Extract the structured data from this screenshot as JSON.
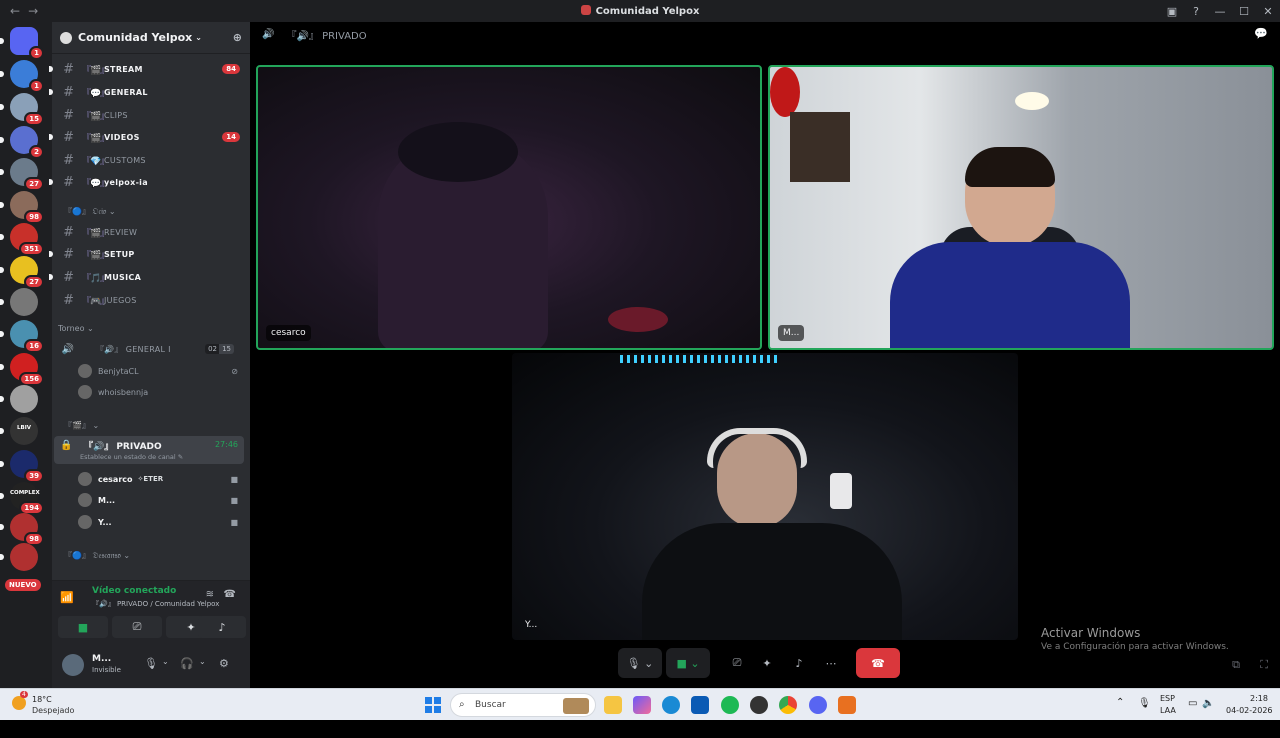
{
  "window": {
    "title": "Comunidad Yelpox",
    "nav_back": "←",
    "nav_forward": "→",
    "controls": [
      "▣",
      "?",
      "—",
      "☐",
      "✕"
    ]
  },
  "servers": [
    {
      "badge": "1",
      "color": "#5865f2"
    },
    {
      "badge": "1",
      "color": "#3b7dd8"
    },
    {
      "badge": "15",
      "color": "#8aa0b8"
    },
    {
      "badge": "2",
      "color": "#5a6fd0"
    },
    {
      "badge": "27",
      "color": "#6b7b8b"
    },
    {
      "badge": "98",
      "color": "#8b6b5b"
    },
    {
      "badge": "351",
      "color": "#c8302a"
    },
    {
      "badge": "27",
      "color": "#e8c020"
    },
    {
      "badge": "",
      "color": "#777"
    },
    {
      "badge": "16",
      "color": "#4a90b0"
    },
    {
      "badge": "156",
      "color": "#d02020"
    },
    {
      "badge": "",
      "color": "#a0a0a0"
    },
    {
      "badge": "",
      "color": "#333",
      "text": "LBIV"
    },
    {
      "badge": "39",
      "color": "#1b2a6b"
    },
    {
      "badge": "194",
      "color": "#222",
      "text": "COMPLEX"
    },
    {
      "badge": "98",
      "color": "#b03030"
    },
    {
      "badge": "",
      "color": "#b03030"
    }
  ],
  "nuevo_label": "NUEVO",
  "guild": {
    "name": "Comunidad Yelpox",
    "caret": "⌄"
  },
  "channels": [
    {
      "emo": "『🎬』",
      "name": "STREAM",
      "unread": true,
      "count": "84"
    },
    {
      "emo": "『💬』",
      "name": "GENERAL",
      "unread": true,
      "count": ""
    },
    {
      "emo": "『🎬』",
      "name": "CLIPS",
      "unread": false,
      "count": ""
    },
    {
      "emo": "『🎬』",
      "name": "VIDEOS",
      "unread": true,
      "count": "14"
    },
    {
      "emo": "『💎』",
      "name": "CUSTOMS",
      "unread": false,
      "count": ""
    },
    {
      "emo": "『💬』",
      "name": "yelpox-ia",
      "unread": true,
      "count": ""
    }
  ],
  "category_ocio": "『🔵』 𝔒𝔠𝔦𝔬 ⌄",
  "channels_ocio": [
    {
      "emo": "『🎬』",
      "name": "REVIEW",
      "unread": false
    },
    {
      "emo": "『🎬』",
      "name": "SETUP",
      "unread": true
    },
    {
      "emo": "『🎵』",
      "name": "MUSICA",
      "unread": true
    },
    {
      "emo": "『🎮』",
      "name": "JUEGOS",
      "unread": false
    }
  ],
  "category_torneo": "Torneo ⌄",
  "voice_general": {
    "name": "『🔊』 GENERAL I",
    "counts": [
      "02",
      "15"
    ]
  },
  "voice_general_members": [
    "BenjytaCL",
    "whoisbennja"
  ],
  "category_unnamed": "『🎬』 ⌄",
  "voice_private": {
    "name": "『🔊』 PRIVADO",
    "time": "27:46",
    "status": "Establece un estado de canal ✎"
  },
  "voice_private_members": [
    {
      "name": "cesarco",
      "tag": "✧ETER"
    },
    {
      "name": "M...",
      "tag": ""
    },
    {
      "name": "Y...",
      "tag": ""
    }
  ],
  "category_descanso": "『🔵』 𝔇𝔢𝔰𝔠𝔞𝔫𝔰𝔬 ⌄",
  "voice_panel": {
    "status": "Vídeo conectado",
    "location": "『🔊』 PRIVADO / Comunidad Yelpox"
  },
  "user": {
    "name": "M...",
    "status": "Invisible"
  },
  "stage": {
    "channel": "『🔊』 PRIVADO"
  },
  "tiles": [
    {
      "label": "cesarco",
      "speaking": true
    },
    {
      "label": "M...",
      "speaking": true
    },
    {
      "label": "Y...",
      "speaking": false
    }
  ],
  "watermark": {
    "title": "Activar Windows",
    "subtitle": "Ve a Configuración para activar Windows."
  },
  "taskbar": {
    "weather_temp": "18°C",
    "weather_cond": "Despejado",
    "weather_badge": "4",
    "search_placeholder": "Buscar",
    "lang": "ESP",
    "lang2": "LAA",
    "time": "2:18",
    "date": "04-02-2026"
  },
  "colors": {
    "accent_green": "#23a55a",
    "badge_red": "#da373c",
    "sidebar_bg": "#2b2d31"
  }
}
